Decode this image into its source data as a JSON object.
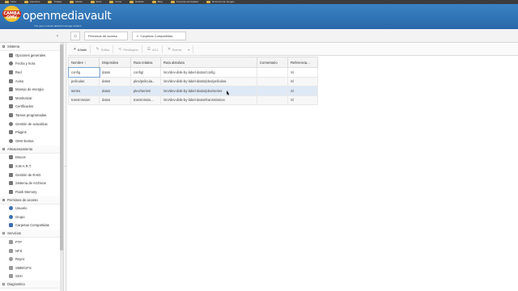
{
  "bookmarks": [
    "Inicio",
    "Favoritos",
    "Trabajo",
    "Media",
    "Docs",
    "Foros",
    "Noticias",
    "Blog",
    "Compras principales",
    "Recursos de Google"
  ],
  "header": {
    "logo_text": "CAMBA OMV",
    "brand": "openmediavault",
    "tagline": "The open network attached storage solution"
  },
  "nav": {
    "collapse_glyph": "‹",
    "home_glyph": "⌂",
    "crumbs": [
      "Permisos de acceso",
      "Carpetas Compartidas"
    ]
  },
  "sidebar": {
    "groups": [
      {
        "label": "Sistema",
        "items": [
          "Opciones generales",
          "Fecha y hora",
          "Red",
          "Aviso",
          "Manejo de energia",
          "Monitorizar",
          "Certificados",
          "Tareas programadas",
          "Gestión de actualizac",
          "Plugins",
          "OMV-Extras"
        ]
      },
      {
        "label": "Almacenamiento",
        "items": [
          "Discos",
          "S.M.A.R.T.",
          "Gestión de RAID",
          "Sistema de Archivos",
          "Flash Memory"
        ]
      },
      {
        "label": "Permisos de acceso",
        "items": [
          "Usuario",
          "Grupo",
          "Carpetas Compartidas"
        ]
      },
      {
        "label": "Servicios",
        "items": [
          "FTP",
          "NFS",
          "Rsync",
          "SMB/CIFS",
          "SSH"
        ]
      },
      {
        "label": "Diagnostico",
        "items": []
      }
    ]
  },
  "toolbar": {
    "add": "Añadir",
    "edit": "Editar",
    "privileges": "Privilegios",
    "acl": "ACL",
    "delete": "Borrar"
  },
  "table": {
    "columns": [
      "Nombre ↑",
      "Dispositivo",
      "Ruta relativa",
      "Ruta absoluta",
      "Comentario",
      "Referencia..."
    ],
    "rows": [
      [
        "config",
        "datos",
        "config/",
        "/srv/dev-disk-by-label-datos/config",
        "",
        "Sí"
      ],
      [
        "peliculas",
        "datos",
        "plex/pelicula...",
        "/srv/dev-disk-by-label-datos/plex/peliculas",
        "",
        "Sí"
      ],
      [
        "series",
        "datos",
        "plex/series/",
        "/srv/dev-disk-by-label-datos/plex/series",
        "",
        "Sí"
      ],
      [
        "transmission",
        "datos",
        "transmissio...",
        "/srv/dev-disk-by-label-datos/transmission",
        "",
        "Sí"
      ]
    ]
  }
}
